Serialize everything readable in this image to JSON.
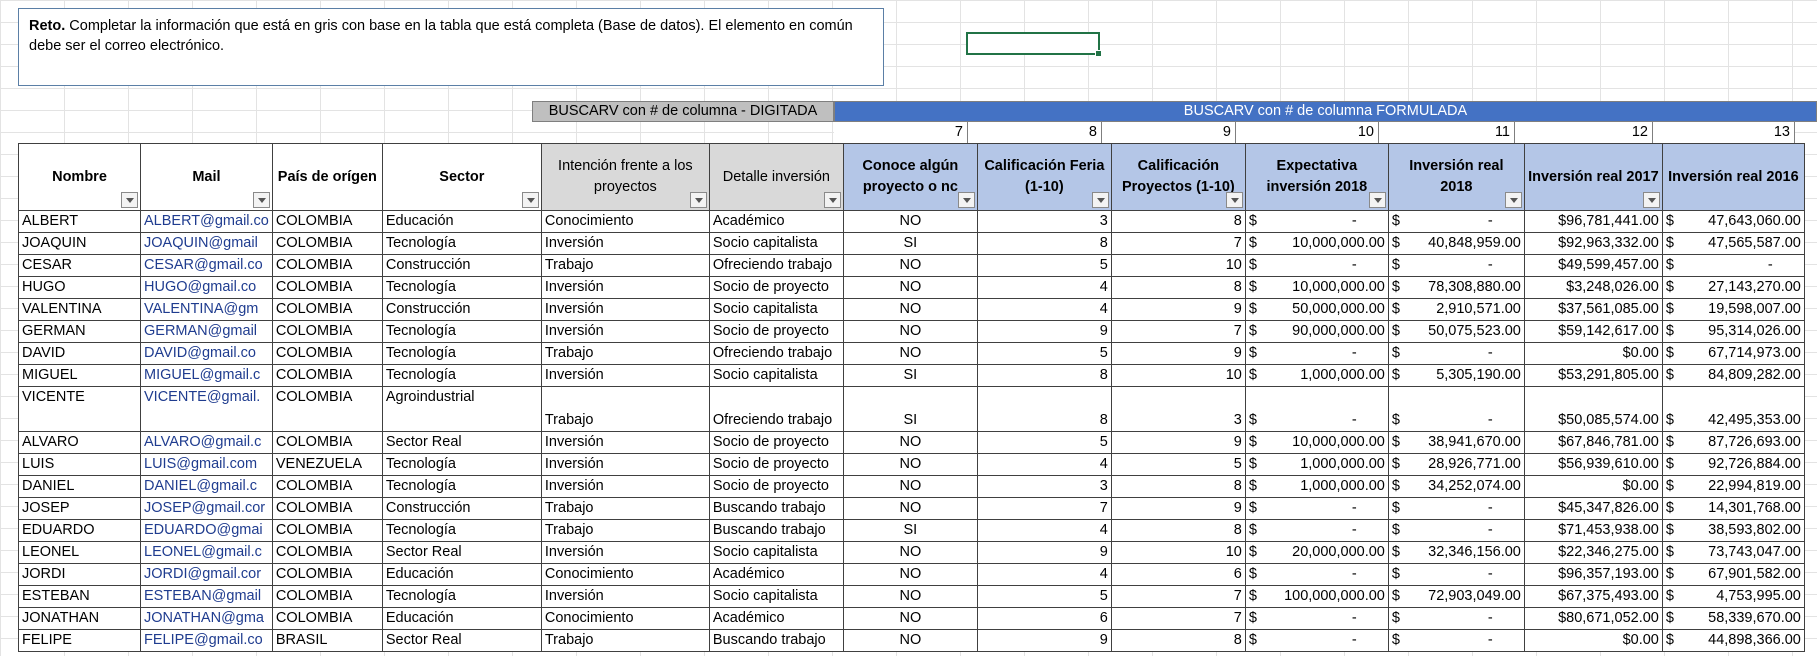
{
  "note": {
    "bold": "Reto.",
    "text": " Completar la información que está en gris con base en la tabla que está completa (Base de datos). El elemento en común debe ser el correo electrónico."
  },
  "bands": {
    "digitada": "BUSCARV con # de columna - DIGITADA",
    "formulada": "BUSCARV con # de columna FORMULADA"
  },
  "col_numbers": [
    "7",
    "8",
    "9",
    "10",
    "11",
    "12",
    "13"
  ],
  "headers": [
    "Nombre",
    "Mail",
    "País de orígen",
    "Sector",
    "Intención frente a los proyectos",
    "Detalle inversión",
    "Conoce algún proyecto o nc",
    "Calificación Feria (1-10)",
    "Calificación Proyectos (1-10)",
    "Expectativa inversión 2018",
    "Inversión real 2018",
    "Inversión real 2017",
    "Inversión real 2016"
  ],
  "rows": [
    [
      "ALBERT",
      "ALBERT@gmail.co",
      "COLOMBIA",
      "Educación",
      "Conocimiento",
      "Académico",
      "NO",
      "3",
      "8",
      "$|-",
      "$|-",
      "$96,781,441.00",
      "$|47,643,060.00"
    ],
    [
      "JOAQUIN",
      "JOAQUIN@gmail",
      "COLOMBIA",
      "Tecnología",
      "Inversión",
      "Socio capitalista",
      "SI",
      "8",
      "7",
      "$|10,000,000.00",
      "$|40,848,959.00",
      "$92,963,332.00",
      "$|47,565,587.00"
    ],
    [
      "CESAR",
      "CESAR@gmail.co",
      "COLOMBIA",
      "Construcción",
      "Trabajo",
      "Ofreciendo trabajo",
      "NO",
      "5",
      "10",
      "$|-",
      "$|-",
      "$49,599,457.00",
      "$|-"
    ],
    [
      "HUGO",
      "HUGO@gmail.co",
      "COLOMBIA",
      "Tecnología",
      "Inversión",
      "Socio de proyecto",
      "NO",
      "4",
      "8",
      "$|10,000,000.00",
      "$|78,308,880.00",
      "$3,248,026.00",
      "$|27,143,270.00"
    ],
    [
      "VALENTINA",
      "VALENTINA@gm",
      "COLOMBIA",
      "Construcción",
      "Inversión",
      "Socio capitalista",
      "NO",
      "4",
      "9",
      "$|50,000,000.00",
      "$|2,910,571.00",
      "$37,561,085.00",
      "$|19,598,007.00"
    ],
    [
      "GERMAN",
      "GERMAN@gmail",
      "COLOMBIA",
      "Tecnología",
      "Inversión",
      "Socio de proyecto",
      "NO",
      "9",
      "7",
      "$|90,000,000.00",
      "$|50,075,523.00",
      "$59,142,617.00",
      "$|95,314,026.00"
    ],
    [
      "DAVID",
      "DAVID@gmail.co",
      "COLOMBIA",
      "Tecnología",
      "Trabajo",
      "Ofreciendo trabajo",
      "NO",
      "5",
      "9",
      "$|-",
      "$|-",
      "$0.00",
      "$|67,714,973.00"
    ],
    [
      "MIGUEL",
      "MIGUEL@gmail.c",
      "COLOMBIA",
      "Tecnología",
      "Inversión",
      "Socio capitalista",
      "SI",
      "8",
      "10",
      "$|1,000,000.00",
      "$|5,305,190.00",
      "$53,291,805.00",
      "$|84,809,282.00"
    ],
    [
      "VICENTE",
      "VICENTE@gmail.",
      "COLOMBIA",
      "Agroindustrial",
      "Trabajo",
      "Ofreciendo trabajo",
      "SI",
      "8",
      "3",
      "$|-",
      "$|-",
      "$50,085,574.00",
      "$|42,495,353.00"
    ],
    [
      "ALVARO",
      "ALVARO@gmail.c",
      "COLOMBIA",
      "Sector Real",
      "Inversión",
      "Socio de proyecto",
      "NO",
      "5",
      "9",
      "$|10,000,000.00",
      "$|38,941,670.00",
      "$67,846,781.00",
      "$|87,726,693.00"
    ],
    [
      "LUIS",
      "LUIS@gmail.com",
      "VENEZUELA",
      "Tecnología",
      "Inversión",
      "Socio de proyecto",
      "NO",
      "4",
      "5",
      "$|1,000,000.00",
      "$|28,926,771.00",
      "$56,939,610.00",
      "$|92,726,884.00"
    ],
    [
      "DANIEL",
      "DANIEL@gmail.c",
      "COLOMBIA",
      "Tecnología",
      "Inversión",
      "Socio de proyecto",
      "NO",
      "3",
      "8",
      "$|1,000,000.00",
      "$|34,252,074.00",
      "$0.00",
      "$|22,994,819.00"
    ],
    [
      "JOSEP",
      "JOSEP@gmail.cor",
      "COLOMBIA",
      "Construcción",
      "Trabajo",
      "Buscando trabajo",
      "NO",
      "7",
      "9",
      "$|-",
      "$|-",
      "$45,347,826.00",
      "$|14,301,768.00"
    ],
    [
      "EDUARDO",
      "EDUARDO@gmai",
      "COLOMBIA",
      "Tecnología",
      "Trabajo",
      "Buscando trabajo",
      "SI",
      "4",
      "8",
      "$|-",
      "$|-",
      "$71,453,938.00",
      "$|38,593,802.00"
    ],
    [
      "LEONEL",
      "LEONEL@gmail.c",
      "COLOMBIA",
      "Sector Real",
      "Inversión",
      "Socio capitalista",
      "NO",
      "9",
      "10",
      "$|20,000,000.00",
      "$|32,346,156.00",
      "$22,346,275.00",
      "$|73,743,047.00"
    ],
    [
      "JORDI",
      "JORDI@gmail.cor",
      "COLOMBIA",
      "Educación",
      "Conocimiento",
      "Académico",
      "NO",
      "4",
      "6",
      "$|-",
      "$|-",
      "$96,357,193.00",
      "$|67,901,582.00"
    ],
    [
      "ESTEBAN",
      "ESTEBAN@gmail",
      "COLOMBIA",
      "Tecnología",
      "Inversión",
      "Socio capitalista",
      "NO",
      "5",
      "7",
      "$|100,000,000.00",
      "$|72,903,049.00",
      "$67,375,493.00",
      "$|4,753,995.00"
    ],
    [
      "JONATHAN",
      "JONATHAN@gma",
      "COLOMBIA",
      "Educación",
      "Conocimiento",
      "Académico",
      "NO",
      "6",
      "7",
      "$|-",
      "$|-",
      "$80,671,052.00",
      "$|58,339,670.00"
    ],
    [
      "FELIPE",
      "FELIPE@gmail.co",
      "BRASIL",
      "Sector Real",
      "Trabajo",
      "Buscando trabajo",
      "NO",
      "9",
      "8",
      "$|-",
      "$|-",
      "$0.00",
      "$|44,898,366.00"
    ]
  ]
}
